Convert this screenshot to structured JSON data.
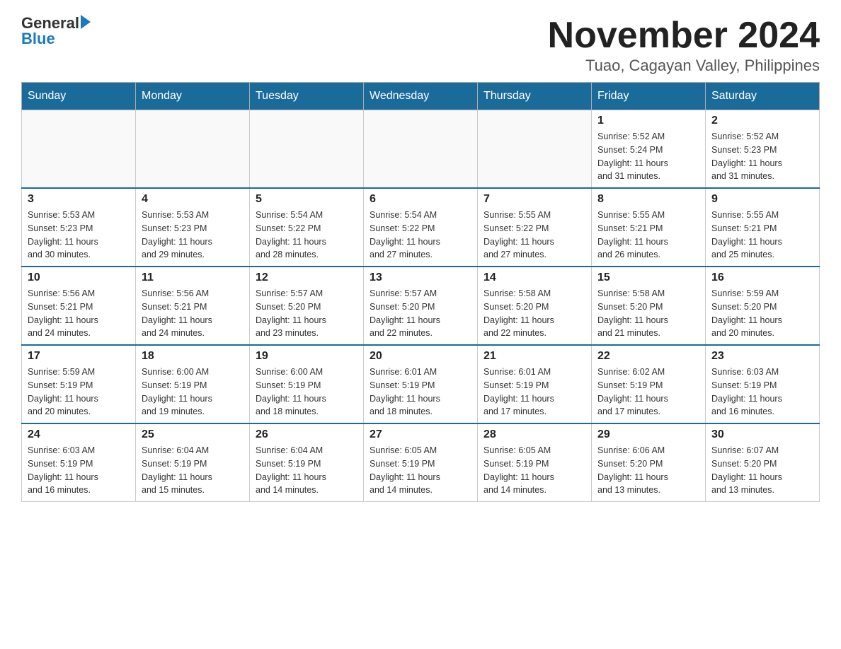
{
  "logo": {
    "general": "General",
    "blue": "Blue",
    "arrow_color": "#1a7abf"
  },
  "title": "November 2024",
  "subtitle": "Tuao, Cagayan Valley, Philippines",
  "header_color": "#1a6b9a",
  "days_of_week": [
    "Sunday",
    "Monday",
    "Tuesday",
    "Wednesday",
    "Thursday",
    "Friday",
    "Saturday"
  ],
  "weeks": [
    {
      "days": [
        {
          "num": "",
          "info": "",
          "empty": true
        },
        {
          "num": "",
          "info": "",
          "empty": true
        },
        {
          "num": "",
          "info": "",
          "empty": true
        },
        {
          "num": "",
          "info": "",
          "empty": true
        },
        {
          "num": "",
          "info": "",
          "empty": true
        },
        {
          "num": "1",
          "info": "Sunrise: 5:52 AM\nSunset: 5:24 PM\nDaylight: 11 hours\nand 31 minutes.",
          "empty": false
        },
        {
          "num": "2",
          "info": "Sunrise: 5:52 AM\nSunset: 5:23 PM\nDaylight: 11 hours\nand 31 minutes.",
          "empty": false
        }
      ]
    },
    {
      "days": [
        {
          "num": "3",
          "info": "Sunrise: 5:53 AM\nSunset: 5:23 PM\nDaylight: 11 hours\nand 30 minutes.",
          "empty": false
        },
        {
          "num": "4",
          "info": "Sunrise: 5:53 AM\nSunset: 5:23 PM\nDaylight: 11 hours\nand 29 minutes.",
          "empty": false
        },
        {
          "num": "5",
          "info": "Sunrise: 5:54 AM\nSunset: 5:22 PM\nDaylight: 11 hours\nand 28 minutes.",
          "empty": false
        },
        {
          "num": "6",
          "info": "Sunrise: 5:54 AM\nSunset: 5:22 PM\nDaylight: 11 hours\nand 27 minutes.",
          "empty": false
        },
        {
          "num": "7",
          "info": "Sunrise: 5:55 AM\nSunset: 5:22 PM\nDaylight: 11 hours\nand 27 minutes.",
          "empty": false
        },
        {
          "num": "8",
          "info": "Sunrise: 5:55 AM\nSunset: 5:21 PM\nDaylight: 11 hours\nand 26 minutes.",
          "empty": false
        },
        {
          "num": "9",
          "info": "Sunrise: 5:55 AM\nSunset: 5:21 PM\nDaylight: 11 hours\nand 25 minutes.",
          "empty": false
        }
      ]
    },
    {
      "days": [
        {
          "num": "10",
          "info": "Sunrise: 5:56 AM\nSunset: 5:21 PM\nDaylight: 11 hours\nand 24 minutes.",
          "empty": false
        },
        {
          "num": "11",
          "info": "Sunrise: 5:56 AM\nSunset: 5:21 PM\nDaylight: 11 hours\nand 24 minutes.",
          "empty": false
        },
        {
          "num": "12",
          "info": "Sunrise: 5:57 AM\nSunset: 5:20 PM\nDaylight: 11 hours\nand 23 minutes.",
          "empty": false
        },
        {
          "num": "13",
          "info": "Sunrise: 5:57 AM\nSunset: 5:20 PM\nDaylight: 11 hours\nand 22 minutes.",
          "empty": false
        },
        {
          "num": "14",
          "info": "Sunrise: 5:58 AM\nSunset: 5:20 PM\nDaylight: 11 hours\nand 22 minutes.",
          "empty": false
        },
        {
          "num": "15",
          "info": "Sunrise: 5:58 AM\nSunset: 5:20 PM\nDaylight: 11 hours\nand 21 minutes.",
          "empty": false
        },
        {
          "num": "16",
          "info": "Sunrise: 5:59 AM\nSunset: 5:20 PM\nDaylight: 11 hours\nand 20 minutes.",
          "empty": false
        }
      ]
    },
    {
      "days": [
        {
          "num": "17",
          "info": "Sunrise: 5:59 AM\nSunset: 5:19 PM\nDaylight: 11 hours\nand 20 minutes.",
          "empty": false
        },
        {
          "num": "18",
          "info": "Sunrise: 6:00 AM\nSunset: 5:19 PM\nDaylight: 11 hours\nand 19 minutes.",
          "empty": false
        },
        {
          "num": "19",
          "info": "Sunrise: 6:00 AM\nSunset: 5:19 PM\nDaylight: 11 hours\nand 18 minutes.",
          "empty": false
        },
        {
          "num": "20",
          "info": "Sunrise: 6:01 AM\nSunset: 5:19 PM\nDaylight: 11 hours\nand 18 minutes.",
          "empty": false
        },
        {
          "num": "21",
          "info": "Sunrise: 6:01 AM\nSunset: 5:19 PM\nDaylight: 11 hours\nand 17 minutes.",
          "empty": false
        },
        {
          "num": "22",
          "info": "Sunrise: 6:02 AM\nSunset: 5:19 PM\nDaylight: 11 hours\nand 17 minutes.",
          "empty": false
        },
        {
          "num": "23",
          "info": "Sunrise: 6:03 AM\nSunset: 5:19 PM\nDaylight: 11 hours\nand 16 minutes.",
          "empty": false
        }
      ]
    },
    {
      "days": [
        {
          "num": "24",
          "info": "Sunrise: 6:03 AM\nSunset: 5:19 PM\nDaylight: 11 hours\nand 16 minutes.",
          "empty": false
        },
        {
          "num": "25",
          "info": "Sunrise: 6:04 AM\nSunset: 5:19 PM\nDaylight: 11 hours\nand 15 minutes.",
          "empty": false
        },
        {
          "num": "26",
          "info": "Sunrise: 6:04 AM\nSunset: 5:19 PM\nDaylight: 11 hours\nand 14 minutes.",
          "empty": false
        },
        {
          "num": "27",
          "info": "Sunrise: 6:05 AM\nSunset: 5:19 PM\nDaylight: 11 hours\nand 14 minutes.",
          "empty": false
        },
        {
          "num": "28",
          "info": "Sunrise: 6:05 AM\nSunset: 5:19 PM\nDaylight: 11 hours\nand 14 minutes.",
          "empty": false
        },
        {
          "num": "29",
          "info": "Sunrise: 6:06 AM\nSunset: 5:20 PM\nDaylight: 11 hours\nand 13 minutes.",
          "empty": false
        },
        {
          "num": "30",
          "info": "Sunrise: 6:07 AM\nSunset: 5:20 PM\nDaylight: 11 hours\nand 13 minutes.",
          "empty": false
        }
      ]
    }
  ]
}
